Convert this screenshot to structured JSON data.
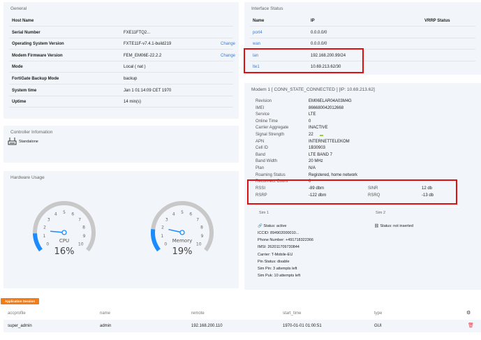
{
  "general": {
    "title": "General",
    "rows": [
      {
        "label": "Host Name",
        "value": ""
      },
      {
        "label": "Serial Number",
        "value": "FXE11FTQ2..."
      },
      {
        "label": "Operating System Version",
        "value": "FXTE11F-v7.4.1-build219",
        "action": "Change"
      },
      {
        "label": "Modem Firmware Version",
        "value": "FEM_EM06E-22.2.2",
        "action": "Change"
      },
      {
        "label": "Mode",
        "value": "Local ( nat )"
      },
      {
        "label": "FortiGate Backup Mode",
        "value": "backup"
      },
      {
        "label": "System time",
        "value": "Jan 1 01:14:09 CET 1970"
      },
      {
        "label": "Uptime",
        "value": "14 min(s)"
      }
    ]
  },
  "controller": {
    "title": "Controller Infomation",
    "status": "Standalone"
  },
  "hardware": {
    "title": "Hardware Usage",
    "gauges": [
      {
        "label": "CPU",
        "value": 16,
        "text": "16%"
      },
      {
        "label": "Memory",
        "value": 19,
        "text": "19%"
      }
    ],
    "ticks": [
      "0",
      "1",
      "2",
      "3",
      "4",
      "5",
      "6",
      "7",
      "8",
      "9",
      "10"
    ],
    "accent": "#1a8cff"
  },
  "interfaces": {
    "title": "Interface Status",
    "headers": [
      "Name",
      "IP",
      "VRRP Status"
    ],
    "rows": [
      {
        "name": "port4",
        "ip": "0.0.0.0/0"
      },
      {
        "name": "wan",
        "ip": "0.0.0.0/0"
      },
      {
        "name": "lan",
        "ip": "192.168.200.99/24"
      },
      {
        "name": "lte1",
        "ip": "10.69.213.62/30"
      }
    ]
  },
  "modem": {
    "title": "Modem 1 [ CONN_STATE_CONNECTED ] [IP: 10.69.213.62]",
    "rows": [
      {
        "label": "Revision",
        "value": "EM06ELAR04A03M4G"
      },
      {
        "label": "IMEI",
        "value": "866680042012668"
      },
      {
        "label": "Service",
        "value": "LTE"
      },
      {
        "label": "Online Time",
        "value": "0"
      },
      {
        "label": "Carrier Aggregate",
        "value": "INACTIVE"
      },
      {
        "label": "Signal Strength",
        "value": "22"
      },
      {
        "label": "APN",
        "value": "INTERNETTELEKOM"
      },
      {
        "label": "Cell ID",
        "value": "1B30903"
      },
      {
        "label": "Band",
        "value": "LTE BAND 7"
      },
      {
        "label": "Band Width",
        "value": "20 MHz"
      },
      {
        "label": "Plan",
        "value": "N/A"
      },
      {
        "label": "Roaming Status",
        "value": "Registered, home network"
      },
      {
        "label": "Reconnect Count",
        "value": "0"
      }
    ],
    "rssi": {
      "label": "RSSI",
      "value": "-89 dbm"
    },
    "sinr": {
      "label": "SINR",
      "value": "12 db"
    },
    "rsrp": {
      "label": "RSRP",
      "value": "-122 dbm"
    },
    "rsrq": {
      "label": "RSRQ",
      "value": "-13 db"
    },
    "sim1": {
      "title": "Sim 1",
      "status": "Status: active",
      "lines": [
        "ICCID: 894902000010...",
        "Phone Number: +491718322366",
        "IMSI: 262011709730844",
        "Carrier: T-Mobile-EU",
        "Pin Status: disable",
        "Sim Pin: 3 attempts left",
        "Sim Puk: 10 attempts left"
      ]
    },
    "sim2": {
      "title": "Sim 2",
      "status": "Status: not inserted"
    }
  },
  "sessions": {
    "tag": "Application Session",
    "headers": [
      "accprofile",
      "name",
      "remote",
      "start_time",
      "type"
    ],
    "rows": [
      {
        "accprofile": "super_admin",
        "name": "admin",
        "remote": "192.168.200.110",
        "start_time": "1970-01-01 01:00:51",
        "type": "GUI"
      }
    ]
  }
}
